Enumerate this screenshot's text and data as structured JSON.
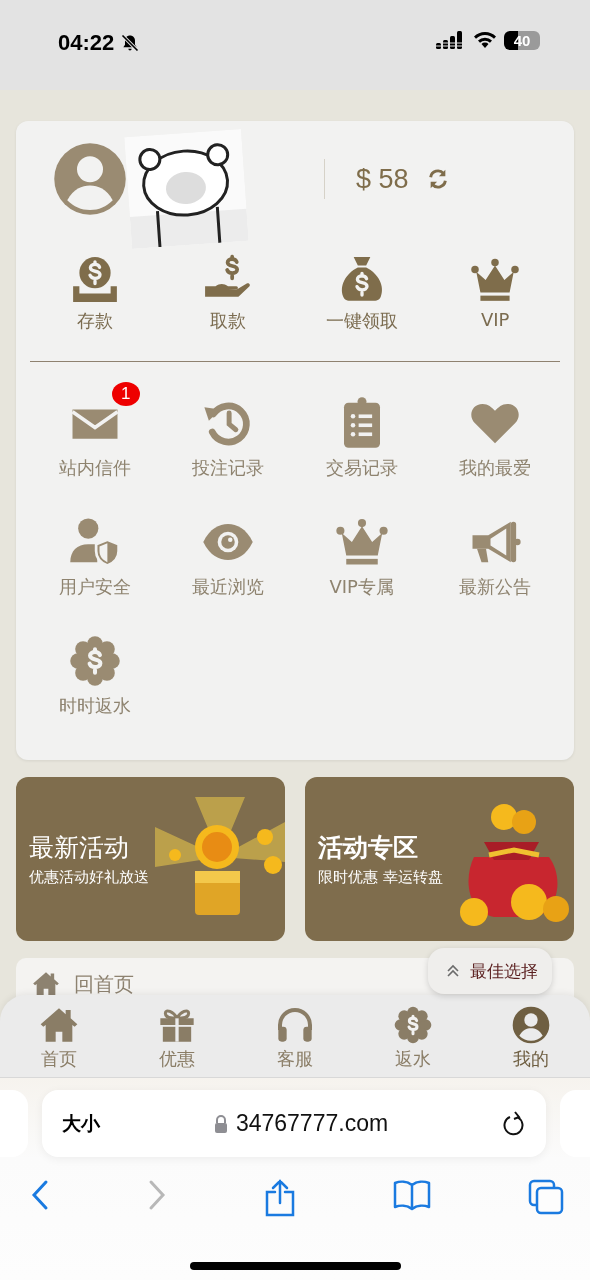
{
  "status_bar": {
    "time": "04:22",
    "battery": "40"
  },
  "account": {
    "balance": "$ 58"
  },
  "quick_actions": [
    {
      "label": "存款"
    },
    {
      "label": "取款"
    },
    {
      "label": "一键领取"
    },
    {
      "label": "VIP"
    }
  ],
  "menu": [
    {
      "label": "站内信件",
      "badge": "1"
    },
    {
      "label": "投注记录"
    },
    {
      "label": "交易记录"
    },
    {
      "label": "我的最爱"
    },
    {
      "label": "用户安全"
    },
    {
      "label": "最近浏览"
    },
    {
      "label": "VIP专属"
    },
    {
      "label": "最新公告"
    },
    {
      "label": "时时返水"
    }
  ],
  "banners": [
    {
      "title": "最新活动",
      "bold": false,
      "subtitle": "优惠活动好礼放送"
    },
    {
      "title": "活动专区",
      "bold": true,
      "subtitle": "限时优惠 幸运转盘"
    }
  ],
  "home_link": {
    "label": "回首页"
  },
  "float_button": {
    "label": "最佳选择"
  },
  "tab_bar": [
    {
      "label": "首页",
      "selected": false
    },
    {
      "label": "优惠",
      "selected": false
    },
    {
      "label": "客服",
      "selected": false
    },
    {
      "label": "返水",
      "selected": false
    },
    {
      "label": "我的",
      "selected": true
    }
  ],
  "browser": {
    "text_size": "大小",
    "url": "34767777.com",
    "back_disabled": false,
    "forward_disabled": true
  }
}
